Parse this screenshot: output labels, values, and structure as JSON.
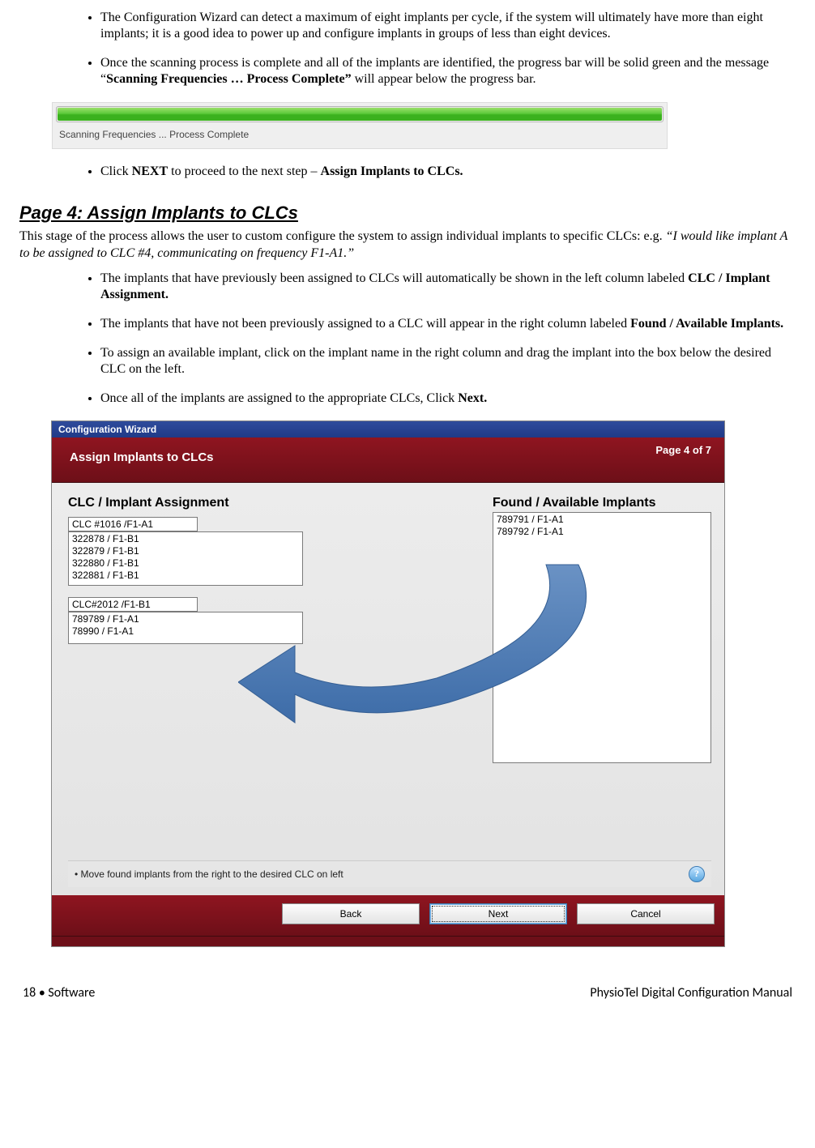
{
  "bullets_top": [
    {
      "pre": "The Configuration Wizard can detect a maximum of eight implants per cycle, if the system will ultimately have more than eight implants; it is a good idea to power up and configure implants in groups of less than eight devices."
    },
    {
      "pre": "Once the scanning process is complete and all of the implants are identified, the progress bar will be solid green and the message “",
      "bold": "Scanning Frequencies … Process Complete”",
      "post": " will appear below the progress bar."
    }
  ],
  "progress_text": "Scanning Frequencies   ...   Process Complete",
  "bullet_next": {
    "pre": "Click ",
    "b1": "NEXT",
    "mid": " to proceed to the next step – ",
    "b2": "Assign Implants to CLCs."
  },
  "section_title": "Page 4: Assign Implants to CLCs",
  "section_intro_pre": "This stage of the process allows the user to custom configure the system to assign individual implants to specific CLCs: e.g. ",
  "section_intro_italic": "“I would like implant A to be assigned to CLC #4, communicating on frequency F1-A1.”",
  "bullets_body": [
    {
      "pre": "The implants that have previously been assigned to CLCs will automatically be shown in the left column labeled ",
      "bold": "CLC / Implant Assignment."
    },
    {
      "pre": "The implants that have not been previously assigned to a CLC will appear in the right column labeled ",
      "bold": "Found / Available Implants."
    },
    {
      "pre": "To assign an available implant, click on the implant name in the right column and drag the implant into the box below the desired CLC on the left."
    },
    {
      "pre": "Once all of the implants are assigned to the appropriate CLCs, Click ",
      "bold": "Next."
    }
  ],
  "wizard": {
    "window_title": "Configuration Wizard",
    "page_of": "Page 4 of 7",
    "step_name": "Assign Implants to CLCs",
    "left_head": "CLC / Implant Assignment",
    "right_head": "Found / Available Implants",
    "clc1_label": "CLC #1016 /F1-A1",
    "clc1_items": [
      "322878 / F1-B1",
      "322879 / F1-B1",
      "322880 / F1-B1",
      "322881 / F1-B1"
    ],
    "clc2_label": "CLC#2012 /F1-B1",
    "clc2_items": [
      "789789 / F1-A1",
      "78990 / F1-A1"
    ],
    "avail_items": [
      "789791 / F1-A1",
      "789792 / F1-A1"
    ],
    "tip": "• Move found implants from the right to the desired CLC on left",
    "btn_back": "Back",
    "btn_next": "Next",
    "btn_cancel": "Cancel"
  },
  "footer": {
    "left": "18  •  Software",
    "right": "PhysioTel Digital Configuration Manual"
  }
}
